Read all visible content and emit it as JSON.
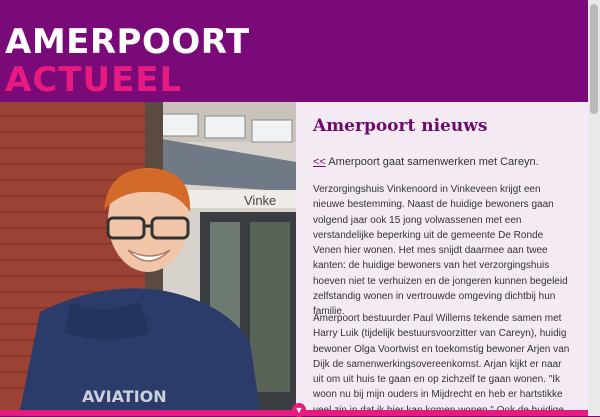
{
  "header": {
    "title_line1": "AMERPOORT",
    "title_line2": "ACTUEEL"
  },
  "article": {
    "heading": "Amerpoort nieuws",
    "back_glyph": "<<",
    "back_text": "Amerpoort gaat samenwerken met Careyn.",
    "paragraph1": "Verzorgingshuis Vinkenoord in Vinkeveen krijgt een nieuwe bestemming. Naast de huidige bewoners gaan volgend jaar ook 15 jong volwassenen met een verstandelijke beperking uit de gemeente De Ronde Venen hier wonen. Het mes snijdt daarmee aan twee kanten: de huidige bewoners van het verzorgingshuis hoeven niet te verhuizen en de jongeren kunnen begeleid zelfstandig wonen in vertrouwde omgeving dichtbij hun familie.",
    "paragraph2": "Amerpoort bestuurder Paul Willems tekende samen met Harry Luik (tijdelijk bestuursvoorzitter van Careyn), huidig bewoner Olga Voortwist en toekomstig bewoner Arjen van Dijk de samenwerkingsovereenkomst. Arjan kijkt er naar uit om uit huis te gaan en op zichzelf te gaan wonen. \"Ik woon nu bij mijn ouders in Mijdrecht en heb er hartstikke veel zin in dat ik hier kan komen wonen.\" Ook de huidige bewoners"
  },
  "photo": {
    "building_sign": "Vinke",
    "shirt_text": "AVIATION"
  },
  "colors": {
    "brand_purple": "#7a0a78",
    "brand_pink": "#e8197f",
    "content_bg": "#f4eaf4"
  },
  "icons": {
    "scroll_down": "chevron-down-icon"
  }
}
